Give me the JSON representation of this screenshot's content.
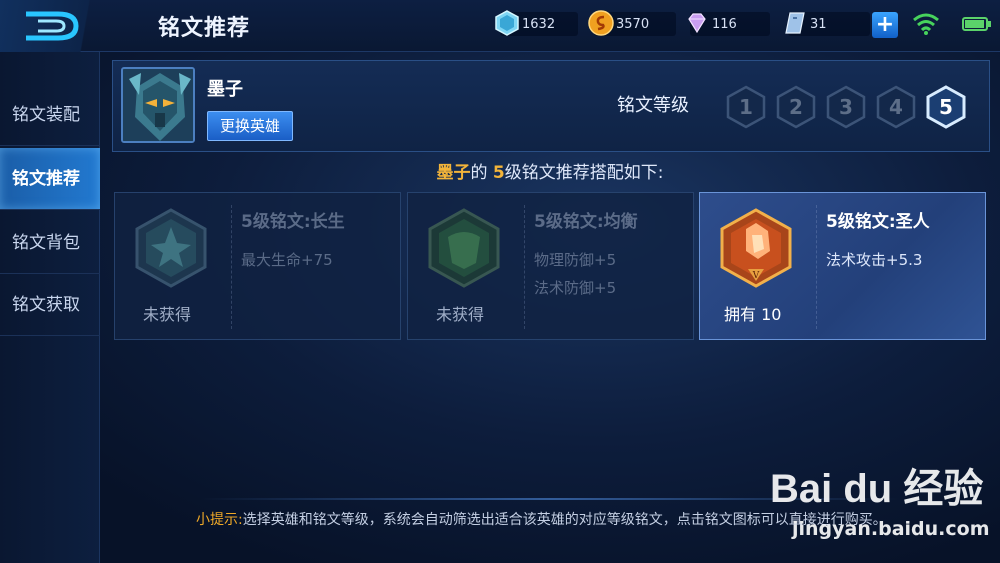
{
  "header": {
    "title": "铭文推荐",
    "resources": [
      {
        "icon": "diamond-icon",
        "value": "1632"
      },
      {
        "icon": "gold-coin-icon",
        "value": "3570"
      },
      {
        "icon": "gem-icon",
        "value": "116"
      },
      {
        "icon": "voucher-icon",
        "value": "31"
      }
    ]
  },
  "sidebar": {
    "items": [
      {
        "label": "铭文装配"
      },
      {
        "label": "铭文推荐"
      },
      {
        "label": "铭文背包"
      },
      {
        "label": "铭文获取"
      }
    ],
    "active_index": 1
  },
  "hero": {
    "name": "墨子",
    "change_button": "更换英雄",
    "level_label": "铭文等级",
    "levels": [
      "1",
      "2",
      "3",
      "4",
      "5"
    ],
    "selected_level": "5"
  },
  "subtitle": {
    "hero": "墨子",
    "mid": "的 ",
    "level": "5",
    "rest": "级铭文推荐搭配如下:"
  },
  "cards": [
    {
      "title": "5级铭文:长生",
      "attrs": [
        "最大生命+75"
      ],
      "status": "未获得",
      "emblem_color": "#3f8a8a"
    },
    {
      "title": "5级铭文:均衡",
      "attrs": [
        "物理防御+5",
        "法术防御+5"
      ],
      "status": "未获得",
      "emblem_color": "#3f7a52"
    },
    {
      "title": "5级铭文:圣人",
      "attrs": [
        "法术攻击+5.3"
      ],
      "status": "拥有 10",
      "emblem_color": "#c8501e"
    }
  ],
  "tip": {
    "label": "小提示:",
    "text": "选择英雄和铭文等级，系统会自动筛选出适合该英雄的对应等级铭文，点击铭文图标可以直接进行购买。"
  },
  "watermark": {
    "logo": "Bai du 经验",
    "url": "jingyan.baidu.com"
  },
  "colors": {
    "accent": "#2279d0",
    "gold": "#f3b43a",
    "background": "#0d1d3c"
  }
}
